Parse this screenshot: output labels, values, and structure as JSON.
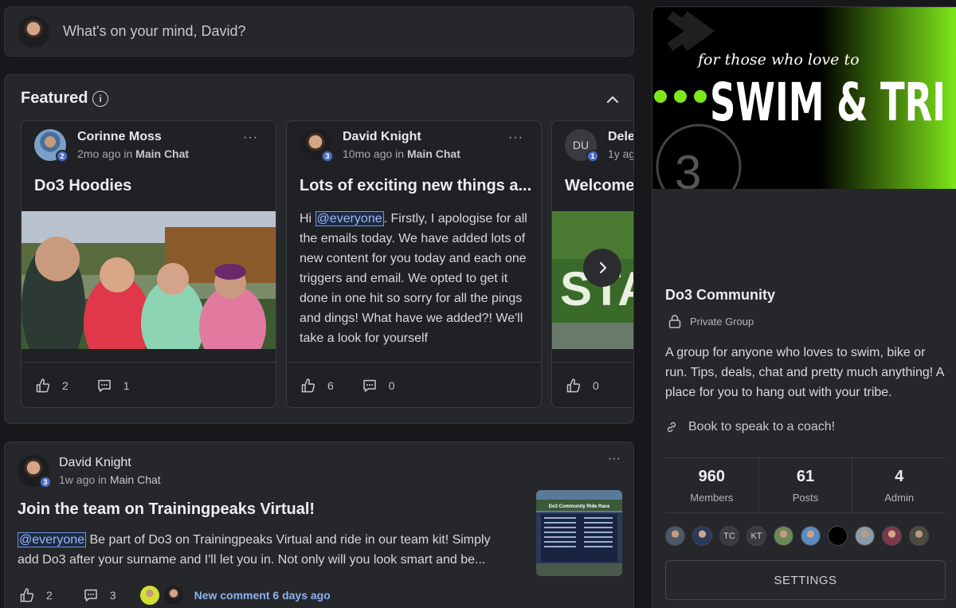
{
  "composer": {
    "placeholder": "What's on your mind, David?"
  },
  "featured": {
    "title": "Featured",
    "cards": [
      {
        "author": "Corinne Moss",
        "badge": "2",
        "time": "2mo ago",
        "in_word": "in",
        "channel": "Main Chat",
        "title": "Do3 Hoodies",
        "likes": "2",
        "comments": "1"
      },
      {
        "author": "David Knight",
        "badge": "3",
        "time": "10mo ago",
        "in_word": "in",
        "channel": "Main Chat",
        "title": "Lots of exciting new things a...",
        "mention": "@everyone",
        "body": ". Firstly, I apologise for all the emails today. We have added lots of new content for you today and each one triggers and email. We opted to get it done in one hit so sorry for all the pings and dings! What have we added?! We'll take a look for yourself",
        "body_prefix": "Hi ",
        "likes": "6",
        "comments": "0"
      },
      {
        "author": "Dele",
        "initials": "DU",
        "badge": "1",
        "time": "1y ag",
        "title": "Welcome",
        "likes": "0",
        "image_text": "STA"
      }
    ]
  },
  "post": {
    "author": "David Knight",
    "badge": "3",
    "time": "1w ago",
    "in_word": "in",
    "channel": "Main Chat",
    "title": "Join the team on Trainingpeaks Virtual!",
    "mention": "@everyone",
    "body": " Be part of Do3 on Trainingpeaks Virtual and ride in our team kit! Simply add Do3 after your surname and I'll let you in. Not only will you look smart and be...",
    "likes": "2",
    "comments": "3",
    "new_comment": "New comment 6 days ago",
    "thumb_caption": "Do3 Community Ride Race"
  },
  "group": {
    "cover_tagline": "for those who love to",
    "cover_title": "SWIM & TRI",
    "cover_number": "3",
    "name": "Do3 Community",
    "privacy": "Private Group",
    "description": "A group for anyone who loves to swim, bike or run. Tips, deals, chat and pretty much anything! A place for you to hang out with your tribe.",
    "coach_link": "Book to speak to a coach!",
    "stats": [
      {
        "value": "960",
        "label": "Members"
      },
      {
        "value": "61",
        "label": "Posts"
      },
      {
        "value": "4",
        "label": "Admin"
      }
    ],
    "member_initials": [
      "TC",
      "KT"
    ],
    "settings_label": "SETTINGS"
  },
  "colors": {
    "accent_green": "#7ee81a",
    "badge_blue": "#4d6fc9",
    "link_blue": "#8cb2ef"
  }
}
